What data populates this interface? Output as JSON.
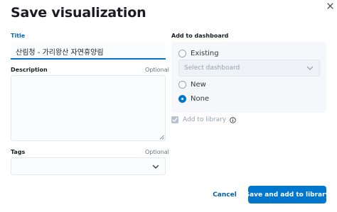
{
  "modal": {
    "title": "Save visualization",
    "close_icon": "close-icon"
  },
  "form": {
    "title_label": "Title",
    "title_value": "산림청 - 가리왕산 자연휴양림",
    "description_label": "Description",
    "description_optional": "Optional",
    "description_value": "",
    "tags_label": "Tags",
    "tags_optional": "Optional",
    "tags_icon": "chevron-down-icon"
  },
  "dashboard": {
    "label": "Add to dashboard",
    "options": [
      {
        "label": "Existing",
        "checked": false
      },
      {
        "label": "New",
        "checked": false
      },
      {
        "label": "None",
        "checked": true
      }
    ],
    "select_placeholder": "Select dashboard",
    "select_icon": "chevron-down-icon"
  },
  "library": {
    "label": "Add to library",
    "checked": true,
    "disabled": true,
    "info_icon": "info-icon"
  },
  "footer": {
    "cancel_label": "Cancel",
    "save_label": "Save and add to library"
  },
  "colors": {
    "accent": "#0077cc",
    "label_accent": "#006bb8",
    "panel_bg": "#f5f7fa",
    "disabled_text": "#98a2b3"
  }
}
